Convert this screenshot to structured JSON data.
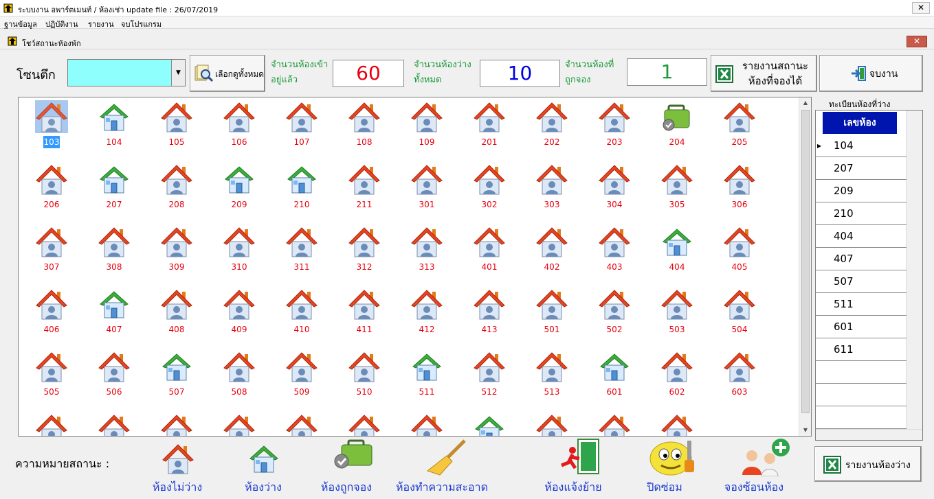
{
  "window": {
    "title": "ระบบงาน อพาร์ตเมนท์ / ห้องเช่า update file : 26/07/2019",
    "close": "✕"
  },
  "menu": [
    "ฐานข้อมูล",
    "ปฏิบัติงาน",
    "รายงาน",
    "จบโปรแกรม"
  ],
  "form": {
    "title": "โชว์สถานะห้องพัก",
    "close": "✕"
  },
  "zone": {
    "label": "โซนตึก",
    "value": ""
  },
  "buttons": {
    "view_all": "เลือกดูทั้งหมด",
    "report_bookable": "รายงานสถานะห้องที่จองได้",
    "end": "จบงาน",
    "report_available": "รายงานห้องว่าง"
  },
  "stats": [
    {
      "label": "จำนวนห้องเข้าอยู่แล้ว",
      "value": "60",
      "color": "#e8000e"
    },
    {
      "label": "จำนวนห้องว่างทั้งหมด",
      "value": "10",
      "color": "#0000e0"
    },
    {
      "label": "จำนวนห้องที่ถูกจอง",
      "value": "1",
      "color": "#1a9a3a"
    }
  ],
  "rooms": [
    {
      "n": "103",
      "s": "occupied",
      "sel": true
    },
    {
      "n": "104",
      "s": "vacant"
    },
    {
      "n": "105",
      "s": "occupied"
    },
    {
      "n": "106",
      "s": "occupied"
    },
    {
      "n": "107",
      "s": "occupied"
    },
    {
      "n": "108",
      "s": "occupied"
    },
    {
      "n": "109",
      "s": "occupied"
    },
    {
      "n": "201",
      "s": "occupied"
    },
    {
      "n": "202",
      "s": "occupied"
    },
    {
      "n": "203",
      "s": "occupied"
    },
    {
      "n": "204",
      "s": "booked"
    },
    {
      "n": "205",
      "s": "occupied"
    },
    {
      "n": "206",
      "s": "occupied"
    },
    {
      "n": "207",
      "s": "vacant"
    },
    {
      "n": "208",
      "s": "occupied"
    },
    {
      "n": "209",
      "s": "vacant"
    },
    {
      "n": "210",
      "s": "vacant"
    },
    {
      "n": "211",
      "s": "occupied"
    },
    {
      "n": "301",
      "s": "occupied"
    },
    {
      "n": "302",
      "s": "occupied"
    },
    {
      "n": "303",
      "s": "occupied"
    },
    {
      "n": "304",
      "s": "occupied"
    },
    {
      "n": "305",
      "s": "occupied"
    },
    {
      "n": "306",
      "s": "occupied"
    },
    {
      "n": "307",
      "s": "occupied"
    },
    {
      "n": "308",
      "s": "occupied"
    },
    {
      "n": "309",
      "s": "occupied"
    },
    {
      "n": "310",
      "s": "occupied"
    },
    {
      "n": "311",
      "s": "occupied"
    },
    {
      "n": "312",
      "s": "occupied"
    },
    {
      "n": "313",
      "s": "occupied"
    },
    {
      "n": "401",
      "s": "occupied"
    },
    {
      "n": "402",
      "s": "occupied"
    },
    {
      "n": "403",
      "s": "occupied"
    },
    {
      "n": "404",
      "s": "vacant"
    },
    {
      "n": "405",
      "s": "occupied"
    },
    {
      "n": "406",
      "s": "occupied"
    },
    {
      "n": "407",
      "s": "vacant"
    },
    {
      "n": "408",
      "s": "occupied"
    },
    {
      "n": "409",
      "s": "occupied"
    },
    {
      "n": "410",
      "s": "occupied"
    },
    {
      "n": "411",
      "s": "occupied"
    },
    {
      "n": "412",
      "s": "occupied"
    },
    {
      "n": "413",
      "s": "occupied"
    },
    {
      "n": "501",
      "s": "occupied"
    },
    {
      "n": "502",
      "s": "occupied"
    },
    {
      "n": "503",
      "s": "occupied"
    },
    {
      "n": "504",
      "s": "occupied"
    },
    {
      "n": "505",
      "s": "occupied"
    },
    {
      "n": "506",
      "s": "occupied"
    },
    {
      "n": "507",
      "s": "vacant"
    },
    {
      "n": "508",
      "s": "occupied"
    },
    {
      "n": "509",
      "s": "occupied"
    },
    {
      "n": "510",
      "s": "occupied"
    },
    {
      "n": "511",
      "s": "vacant"
    },
    {
      "n": "512",
      "s": "occupied"
    },
    {
      "n": "513",
      "s": "occupied"
    },
    {
      "n": "601",
      "s": "vacant"
    },
    {
      "n": "602",
      "s": "occupied"
    },
    {
      "n": "603",
      "s": "occupied"
    },
    {
      "n": "",
      "s": "occupied"
    },
    {
      "n": "",
      "s": "occupied"
    },
    {
      "n": "",
      "s": "occupied"
    },
    {
      "n": "",
      "s": "occupied"
    },
    {
      "n": "",
      "s": "occupied"
    },
    {
      "n": "",
      "s": "occupied"
    },
    {
      "n": "",
      "s": "occupied"
    },
    {
      "n": "",
      "s": "vacant"
    },
    {
      "n": "",
      "s": "occupied"
    },
    {
      "n": "",
      "s": "occupied"
    },
    {
      "n": "",
      "s": "occupied"
    }
  ],
  "available": {
    "title": "ทะเบียนห้องที่ว่าง",
    "header": "เลขห้อง",
    "rows": [
      "104",
      "207",
      "209",
      "210",
      "404",
      "407",
      "507",
      "511",
      "601",
      "611"
    ]
  },
  "legend": {
    "title": "ความหมายสถานะ :",
    "items": [
      {
        "label": "ห้องไม่ว่าง",
        "icon": "occupied-house"
      },
      {
        "label": "ห้องว่าง",
        "icon": "vacant-house"
      },
      {
        "label": "ห้องถูกจอง",
        "icon": "booked-luggage"
      },
      {
        "label": "ห้องทำความสะอาด",
        "icon": "cleaning-broom"
      },
      {
        "label": "ห้องแจ้งย้าย",
        "icon": "move-out-exit"
      },
      {
        "label": "ปิดซ่อม",
        "icon": "repair-smiley"
      },
      {
        "label": "จองซ้อนห้อง",
        "icon": "double-booking-people"
      }
    ]
  }
}
